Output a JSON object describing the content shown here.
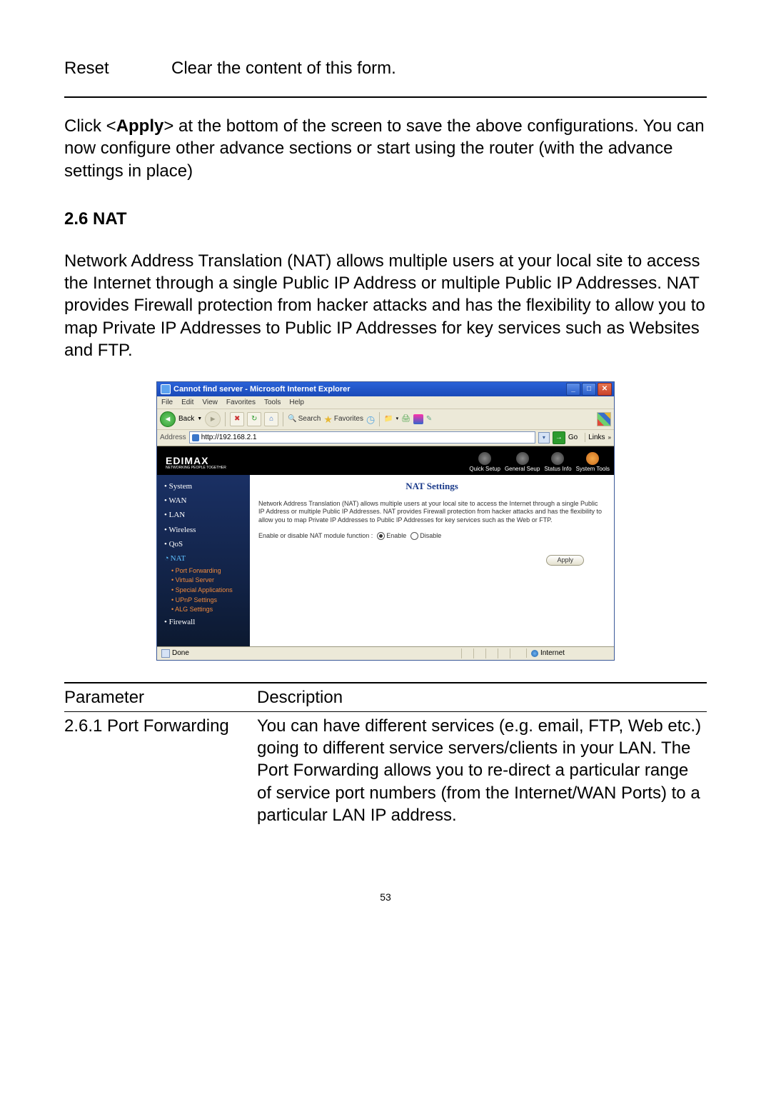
{
  "top_param_label": "Reset",
  "top_param_desc": "Clear the content of this form.",
  "body_text_1a": "Click <",
  "body_text_1b": "Apply",
  "body_text_1c": "> at the bottom of the screen to save the above configurations. You can now configure other advance sections or start using the router (with the advance settings in place)",
  "heading": "2.6 NAT",
  "body_text_2": "Network Address Translation (NAT) allows multiple users at your local site to access the Internet through a single Public IP Address or multiple Public IP Addresses. NAT provides Firewall protection from hacker attacks and has the flexibility to allow you to map Private IP Addresses to Public IP Addresses for key services such as Websites and FTP.",
  "ie": {
    "title": "Cannot find server - Microsoft Internet Explorer",
    "menus": [
      "File",
      "Edit",
      "View",
      "Favorites",
      "Tools",
      "Help"
    ],
    "back_label": "Back",
    "search_label": "Search",
    "favorites_label": "Favorites",
    "address_label": "Address",
    "address_value": "http://192.168.2.1",
    "go_label": "Go",
    "links_label": "Links",
    "status_done": "Done",
    "status_zone": "Internet"
  },
  "router": {
    "logo": "EDIMAX",
    "logo_sub": "NETWORKING PEOPLE TOGETHER",
    "nav": [
      "Quick Setup",
      "General Seup",
      "Status Info",
      "System Tools"
    ],
    "sidebar": {
      "items": [
        "System",
        "WAN",
        "LAN",
        "Wireless",
        "QoS",
        "NAT"
      ],
      "sub": [
        "Port Forwarding",
        "Virtual Server",
        "Special Applications",
        "UPnP Settings",
        "ALG Settings"
      ],
      "last": "Firewall"
    },
    "main": {
      "title": "NAT Settings",
      "desc": "Network Address Translation (NAT) allows multiple users at your local site to access the Internet through a single Public IP Address or multiple Public IP Addresses. NAT provides Firewall protection from hacker attacks and has the flexibility to allow you to map Private IP Addresses to Public IP Addresses for key services such as the Web or FTP.",
      "option_label": "Enable or disable NAT module function :",
      "opt_enable": "Enable",
      "opt_disable": "Disable",
      "apply": "Apply"
    }
  },
  "table": {
    "header_param": "Parameter",
    "header_desc": "Description",
    "row_param": "2.6.1 Port Forwarding",
    "row_desc": "You can have different services (e.g. email, FTP, Web etc.) going to different service servers/clients in your LAN. The Port Forwarding allows you to re-direct a particular range of service port numbers (from the Internet/WAN Ports) to a particular LAN IP address."
  },
  "page_num": "53"
}
